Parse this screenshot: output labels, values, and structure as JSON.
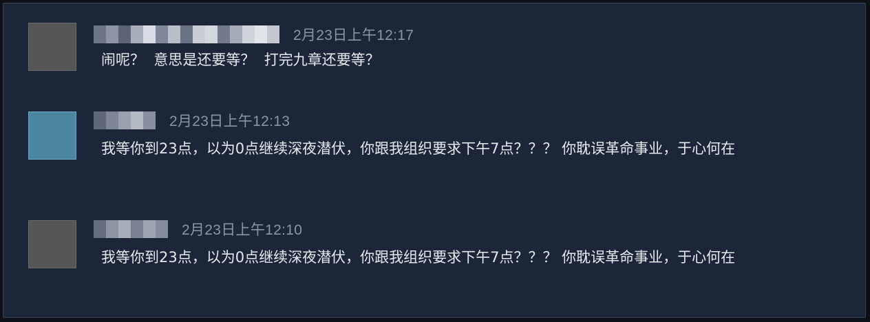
{
  "messages": [
    {
      "timestamp": "2月23日上午12:17",
      "text": "闹呢？  意思是还要等？  打完九章还要等？"
    },
    {
      "timestamp": "2月23日上午12:13",
      "text": "我等你到23点，以为0点继续深夜潜伏，你跟我组织要求下午7点？？？ 你耽误革命事业，于心何在"
    },
    {
      "timestamp": "2月23日上午12:10",
      "text": "我等你到23点，以为0点继续深夜潜伏，你跟我组织要求下午7点？？？ 你耽误革命事业，于心何在"
    }
  ]
}
